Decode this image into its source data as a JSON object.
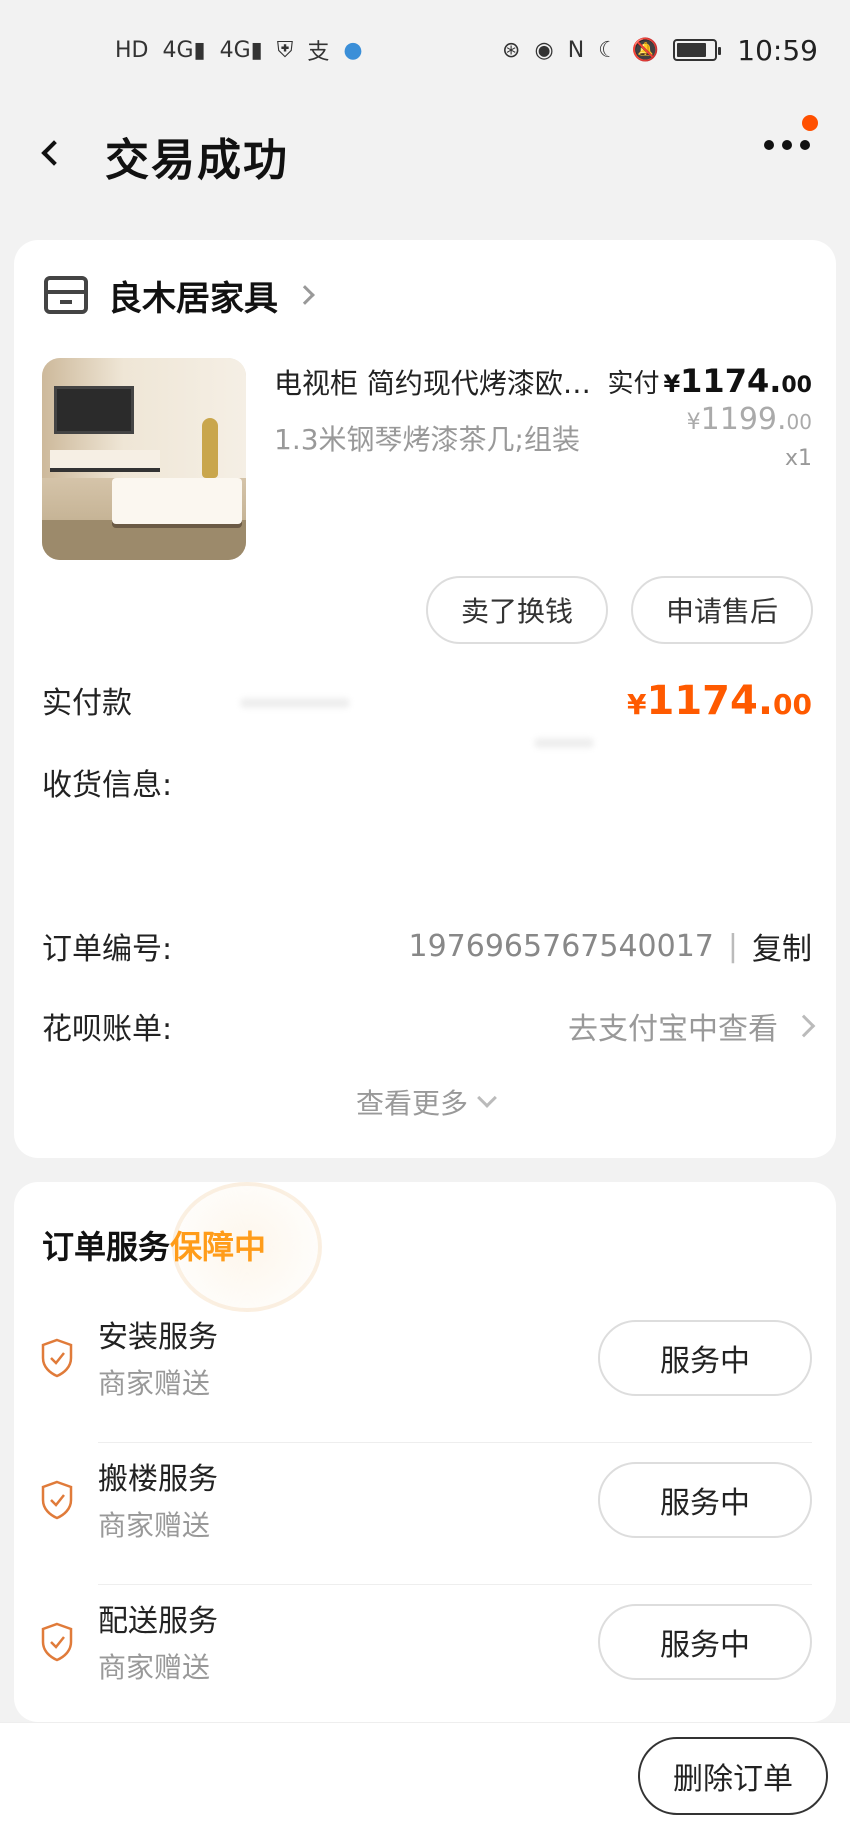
{
  "status_bar": {
    "time": "10:59",
    "left_icons": [
      "hd-icon",
      "signal-4g-icon",
      "signal-4g-icon",
      "shield-icon",
      "alipay-icon",
      "globe-icon"
    ],
    "right_icons": [
      "data-saver-icon",
      "eye-icon",
      "nfc-icon",
      "moon-icon",
      "mute-icon",
      "battery-icon"
    ]
  },
  "nav": {
    "title": "交易成功",
    "has_badge": true,
    "badge_color": "#ff5000"
  },
  "order": {
    "shop_name": "良木居家具",
    "product": {
      "title": "电视柜 简约现代烤漆欧…",
      "spec": "1.3米钢琴烤漆茶几;组装",
      "paid_label": "实付",
      "paid_currency": "¥",
      "paid_int": "1174.",
      "paid_dec": "00",
      "orig_currency": "¥",
      "orig_int": "1199.",
      "orig_dec": "00",
      "quantity": "x1"
    },
    "actions": {
      "resell": "卖了换钱",
      "after_sale": "申请售后"
    },
    "total_label": "实付款",
    "total_currency": "¥",
    "total_int": "1174.",
    "total_dec": "00",
    "shipping_label": "收货信息:",
    "order_no_label": "订单编号:",
    "order_no": "1976965767540017",
    "separator": "|",
    "copy": "复制",
    "huabei_label": "花呗账单:",
    "huabei_link": "去支付宝中查看",
    "see_more": "查看更多"
  },
  "services": {
    "title": "订单服务",
    "guard": "保障中",
    "items": [
      {
        "name": "安装服务",
        "sub": "商家赠送",
        "status": "服务中"
      },
      {
        "name": "搬楼服务",
        "sub": "商家赠送",
        "status": "服务中"
      },
      {
        "name": "配送服务",
        "sub": "商家赠送",
        "status": "服务中"
      }
    ]
  },
  "bottom": {
    "delete_order": "删除订单"
  },
  "colors": {
    "accent": "#ff5a00",
    "guard": "#ff9c1a",
    "shield": "#e07b3a"
  }
}
